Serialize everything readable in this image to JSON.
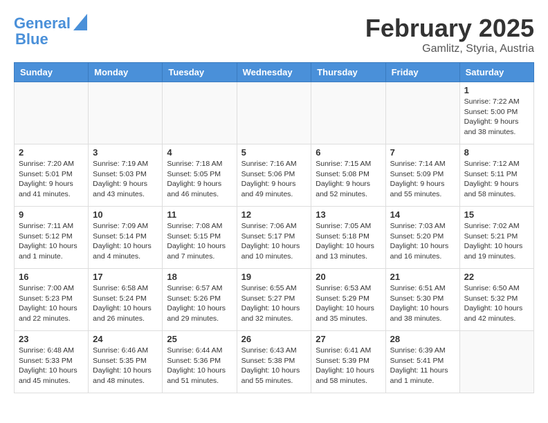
{
  "header": {
    "logo_line1": "General",
    "logo_line2": "Blue",
    "month": "February 2025",
    "location": "Gamlitz, Styria, Austria"
  },
  "weekdays": [
    "Sunday",
    "Monday",
    "Tuesday",
    "Wednesday",
    "Thursday",
    "Friday",
    "Saturday"
  ],
  "weeks": [
    [
      {
        "day": "",
        "info": ""
      },
      {
        "day": "",
        "info": ""
      },
      {
        "day": "",
        "info": ""
      },
      {
        "day": "",
        "info": ""
      },
      {
        "day": "",
        "info": ""
      },
      {
        "day": "",
        "info": ""
      },
      {
        "day": "1",
        "info": "Sunrise: 7:22 AM\nSunset: 5:00 PM\nDaylight: 9 hours and 38 minutes."
      }
    ],
    [
      {
        "day": "2",
        "info": "Sunrise: 7:20 AM\nSunset: 5:01 PM\nDaylight: 9 hours and 41 minutes."
      },
      {
        "day": "3",
        "info": "Sunrise: 7:19 AM\nSunset: 5:03 PM\nDaylight: 9 hours and 43 minutes."
      },
      {
        "day": "4",
        "info": "Sunrise: 7:18 AM\nSunset: 5:05 PM\nDaylight: 9 hours and 46 minutes."
      },
      {
        "day": "5",
        "info": "Sunrise: 7:16 AM\nSunset: 5:06 PM\nDaylight: 9 hours and 49 minutes."
      },
      {
        "day": "6",
        "info": "Sunrise: 7:15 AM\nSunset: 5:08 PM\nDaylight: 9 hours and 52 minutes."
      },
      {
        "day": "7",
        "info": "Sunrise: 7:14 AM\nSunset: 5:09 PM\nDaylight: 9 hours and 55 minutes."
      },
      {
        "day": "8",
        "info": "Sunrise: 7:12 AM\nSunset: 5:11 PM\nDaylight: 9 hours and 58 minutes."
      }
    ],
    [
      {
        "day": "9",
        "info": "Sunrise: 7:11 AM\nSunset: 5:12 PM\nDaylight: 10 hours and 1 minute."
      },
      {
        "day": "10",
        "info": "Sunrise: 7:09 AM\nSunset: 5:14 PM\nDaylight: 10 hours and 4 minutes."
      },
      {
        "day": "11",
        "info": "Sunrise: 7:08 AM\nSunset: 5:15 PM\nDaylight: 10 hours and 7 minutes."
      },
      {
        "day": "12",
        "info": "Sunrise: 7:06 AM\nSunset: 5:17 PM\nDaylight: 10 hours and 10 minutes."
      },
      {
        "day": "13",
        "info": "Sunrise: 7:05 AM\nSunset: 5:18 PM\nDaylight: 10 hours and 13 minutes."
      },
      {
        "day": "14",
        "info": "Sunrise: 7:03 AM\nSunset: 5:20 PM\nDaylight: 10 hours and 16 minutes."
      },
      {
        "day": "15",
        "info": "Sunrise: 7:02 AM\nSunset: 5:21 PM\nDaylight: 10 hours and 19 minutes."
      }
    ],
    [
      {
        "day": "16",
        "info": "Sunrise: 7:00 AM\nSunset: 5:23 PM\nDaylight: 10 hours and 22 minutes."
      },
      {
        "day": "17",
        "info": "Sunrise: 6:58 AM\nSunset: 5:24 PM\nDaylight: 10 hours and 26 minutes."
      },
      {
        "day": "18",
        "info": "Sunrise: 6:57 AM\nSunset: 5:26 PM\nDaylight: 10 hours and 29 minutes."
      },
      {
        "day": "19",
        "info": "Sunrise: 6:55 AM\nSunset: 5:27 PM\nDaylight: 10 hours and 32 minutes."
      },
      {
        "day": "20",
        "info": "Sunrise: 6:53 AM\nSunset: 5:29 PM\nDaylight: 10 hours and 35 minutes."
      },
      {
        "day": "21",
        "info": "Sunrise: 6:51 AM\nSunset: 5:30 PM\nDaylight: 10 hours and 38 minutes."
      },
      {
        "day": "22",
        "info": "Sunrise: 6:50 AM\nSunset: 5:32 PM\nDaylight: 10 hours and 42 minutes."
      }
    ],
    [
      {
        "day": "23",
        "info": "Sunrise: 6:48 AM\nSunset: 5:33 PM\nDaylight: 10 hours and 45 minutes."
      },
      {
        "day": "24",
        "info": "Sunrise: 6:46 AM\nSunset: 5:35 PM\nDaylight: 10 hours and 48 minutes."
      },
      {
        "day": "25",
        "info": "Sunrise: 6:44 AM\nSunset: 5:36 PM\nDaylight: 10 hours and 51 minutes."
      },
      {
        "day": "26",
        "info": "Sunrise: 6:43 AM\nSunset: 5:38 PM\nDaylight: 10 hours and 55 minutes."
      },
      {
        "day": "27",
        "info": "Sunrise: 6:41 AM\nSunset: 5:39 PM\nDaylight: 10 hours and 58 minutes."
      },
      {
        "day": "28",
        "info": "Sunrise: 6:39 AM\nSunset: 5:41 PM\nDaylight: 11 hours and 1 minute."
      },
      {
        "day": "",
        "info": ""
      }
    ]
  ]
}
